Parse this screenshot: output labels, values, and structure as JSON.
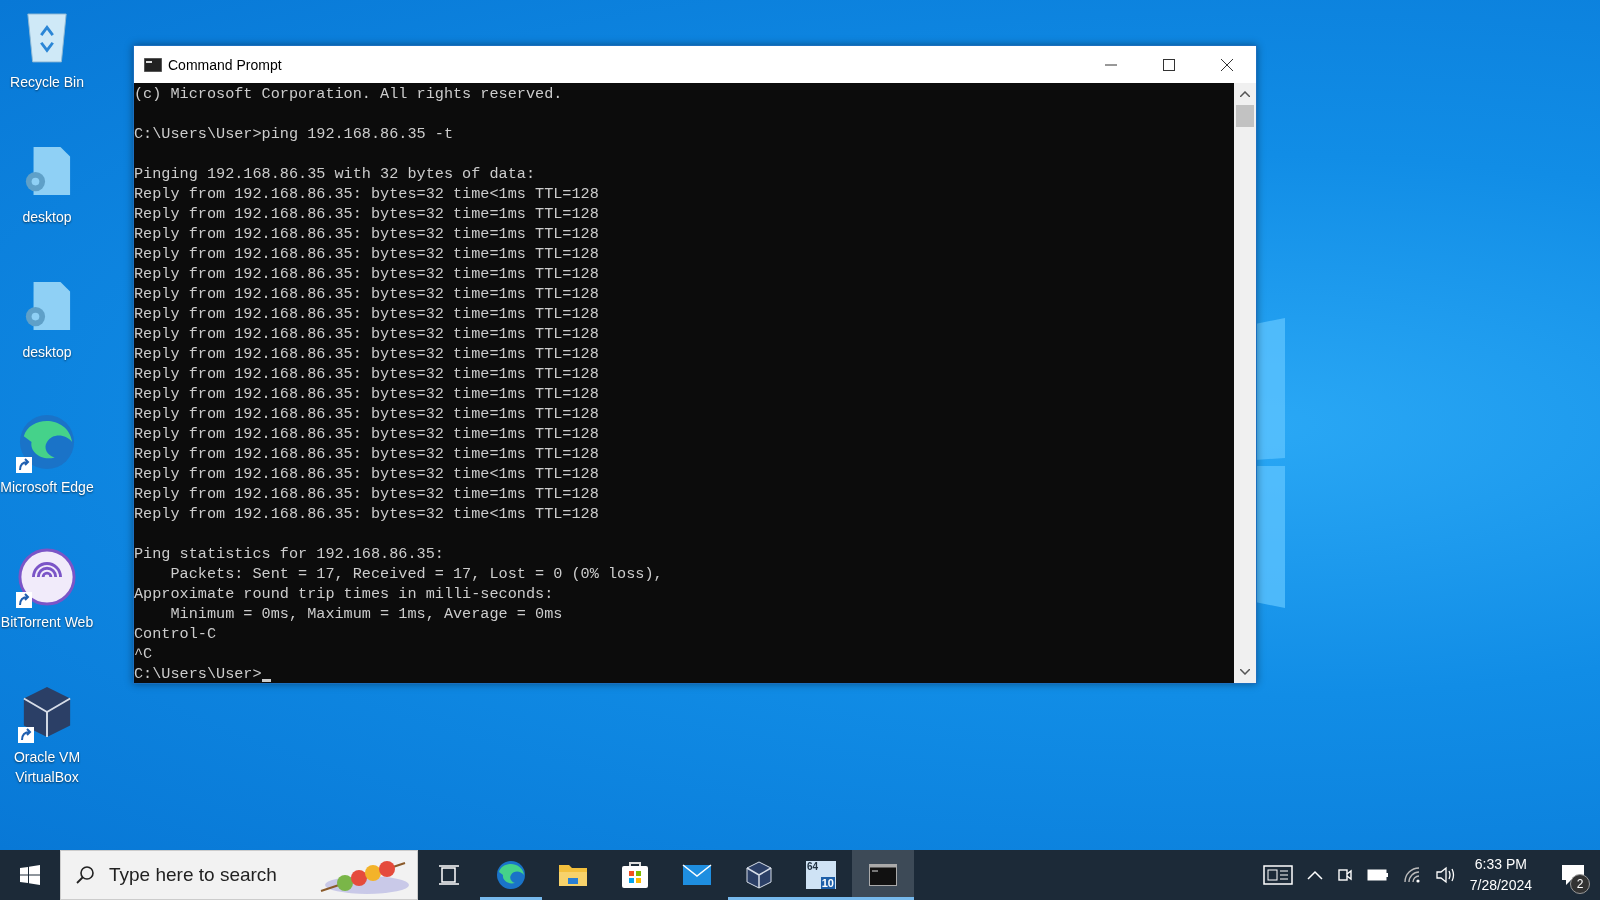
{
  "desktop_icons": [
    {
      "kind": "recycle-bin",
      "label": "Recycle Bin",
      "shortcut": false
    },
    {
      "kind": "settings-file",
      "label": "desktop",
      "shortcut": false
    },
    {
      "kind": "settings-file",
      "label": "desktop",
      "shortcut": false
    },
    {
      "kind": "edge",
      "label": "Microsoft Edge",
      "shortcut": true
    },
    {
      "kind": "torrent",
      "label": "BitTorrent Web",
      "shortcut": true
    },
    {
      "kind": "virtualbox",
      "label": "Oracle VM VirtualBox",
      "shortcut": true
    }
  ],
  "window": {
    "title": "Command Prompt",
    "console_blocks": [
      [
        "(c) Microsoft Corporation. All rights reserved."
      ],
      [
        "C:\\Users\\User>ping 192.168.86.35 -t"
      ],
      [
        "Pinging 192.168.86.35 with 32 bytes of data:",
        "Reply from 192.168.86.35: bytes=32 time<1ms TTL=128",
        "Reply from 192.168.86.35: bytes=32 time=1ms TTL=128",
        "Reply from 192.168.86.35: bytes=32 time=1ms TTL=128",
        "Reply from 192.168.86.35: bytes=32 time=1ms TTL=128",
        "Reply from 192.168.86.35: bytes=32 time=1ms TTL=128",
        "Reply from 192.168.86.35: bytes=32 time=1ms TTL=128",
        "Reply from 192.168.86.35: bytes=32 time=1ms TTL=128",
        "Reply from 192.168.86.35: bytes=32 time=1ms TTL=128",
        "Reply from 192.168.86.35: bytes=32 time=1ms TTL=128",
        "Reply from 192.168.86.35: bytes=32 time=1ms TTL=128",
        "Reply from 192.168.86.35: bytes=32 time=1ms TTL=128",
        "Reply from 192.168.86.35: bytes=32 time=1ms TTL=128",
        "Reply from 192.168.86.35: bytes=32 time=1ms TTL=128",
        "Reply from 192.168.86.35: bytes=32 time=1ms TTL=128",
        "Reply from 192.168.86.35: bytes=32 time<1ms TTL=128",
        "Reply from 192.168.86.35: bytes=32 time=1ms TTL=128",
        "Reply from 192.168.86.35: bytes=32 time<1ms TTL=128"
      ],
      [
        "Ping statistics for 192.168.86.35:",
        "    Packets: Sent = 17, Received = 17, Lost = 0 (0% loss),",
        "Approximate round trip times in milli-seconds:",
        "    Minimum = 0ms, Maximum = 1ms, Average = 0ms",
        "Control-C",
        "^C",
        "C:\\Users\\User>"
      ]
    ]
  },
  "taskbar": {
    "search": {
      "placeholder": "Type here to search"
    },
    "apps": [
      {
        "kind": "task-view",
        "running": false,
        "selected": false
      },
      {
        "kind": "edge",
        "running": true,
        "selected": false
      },
      {
        "kind": "folder",
        "running": false,
        "selected": false
      },
      {
        "kind": "store",
        "running": false,
        "selected": false
      },
      {
        "kind": "mail",
        "running": false,
        "selected": false
      },
      {
        "kind": "virtualbox",
        "running": true,
        "selected": false
      },
      {
        "kind": "os-badge",
        "running": true,
        "selected": false,
        "top_text": "64",
        "bottom_text": "10"
      },
      {
        "kind": "terminal",
        "running": true,
        "selected": true
      }
    ],
    "time": "6:33 PM",
    "date": "7/28/2024",
    "notification_count": "2"
  }
}
